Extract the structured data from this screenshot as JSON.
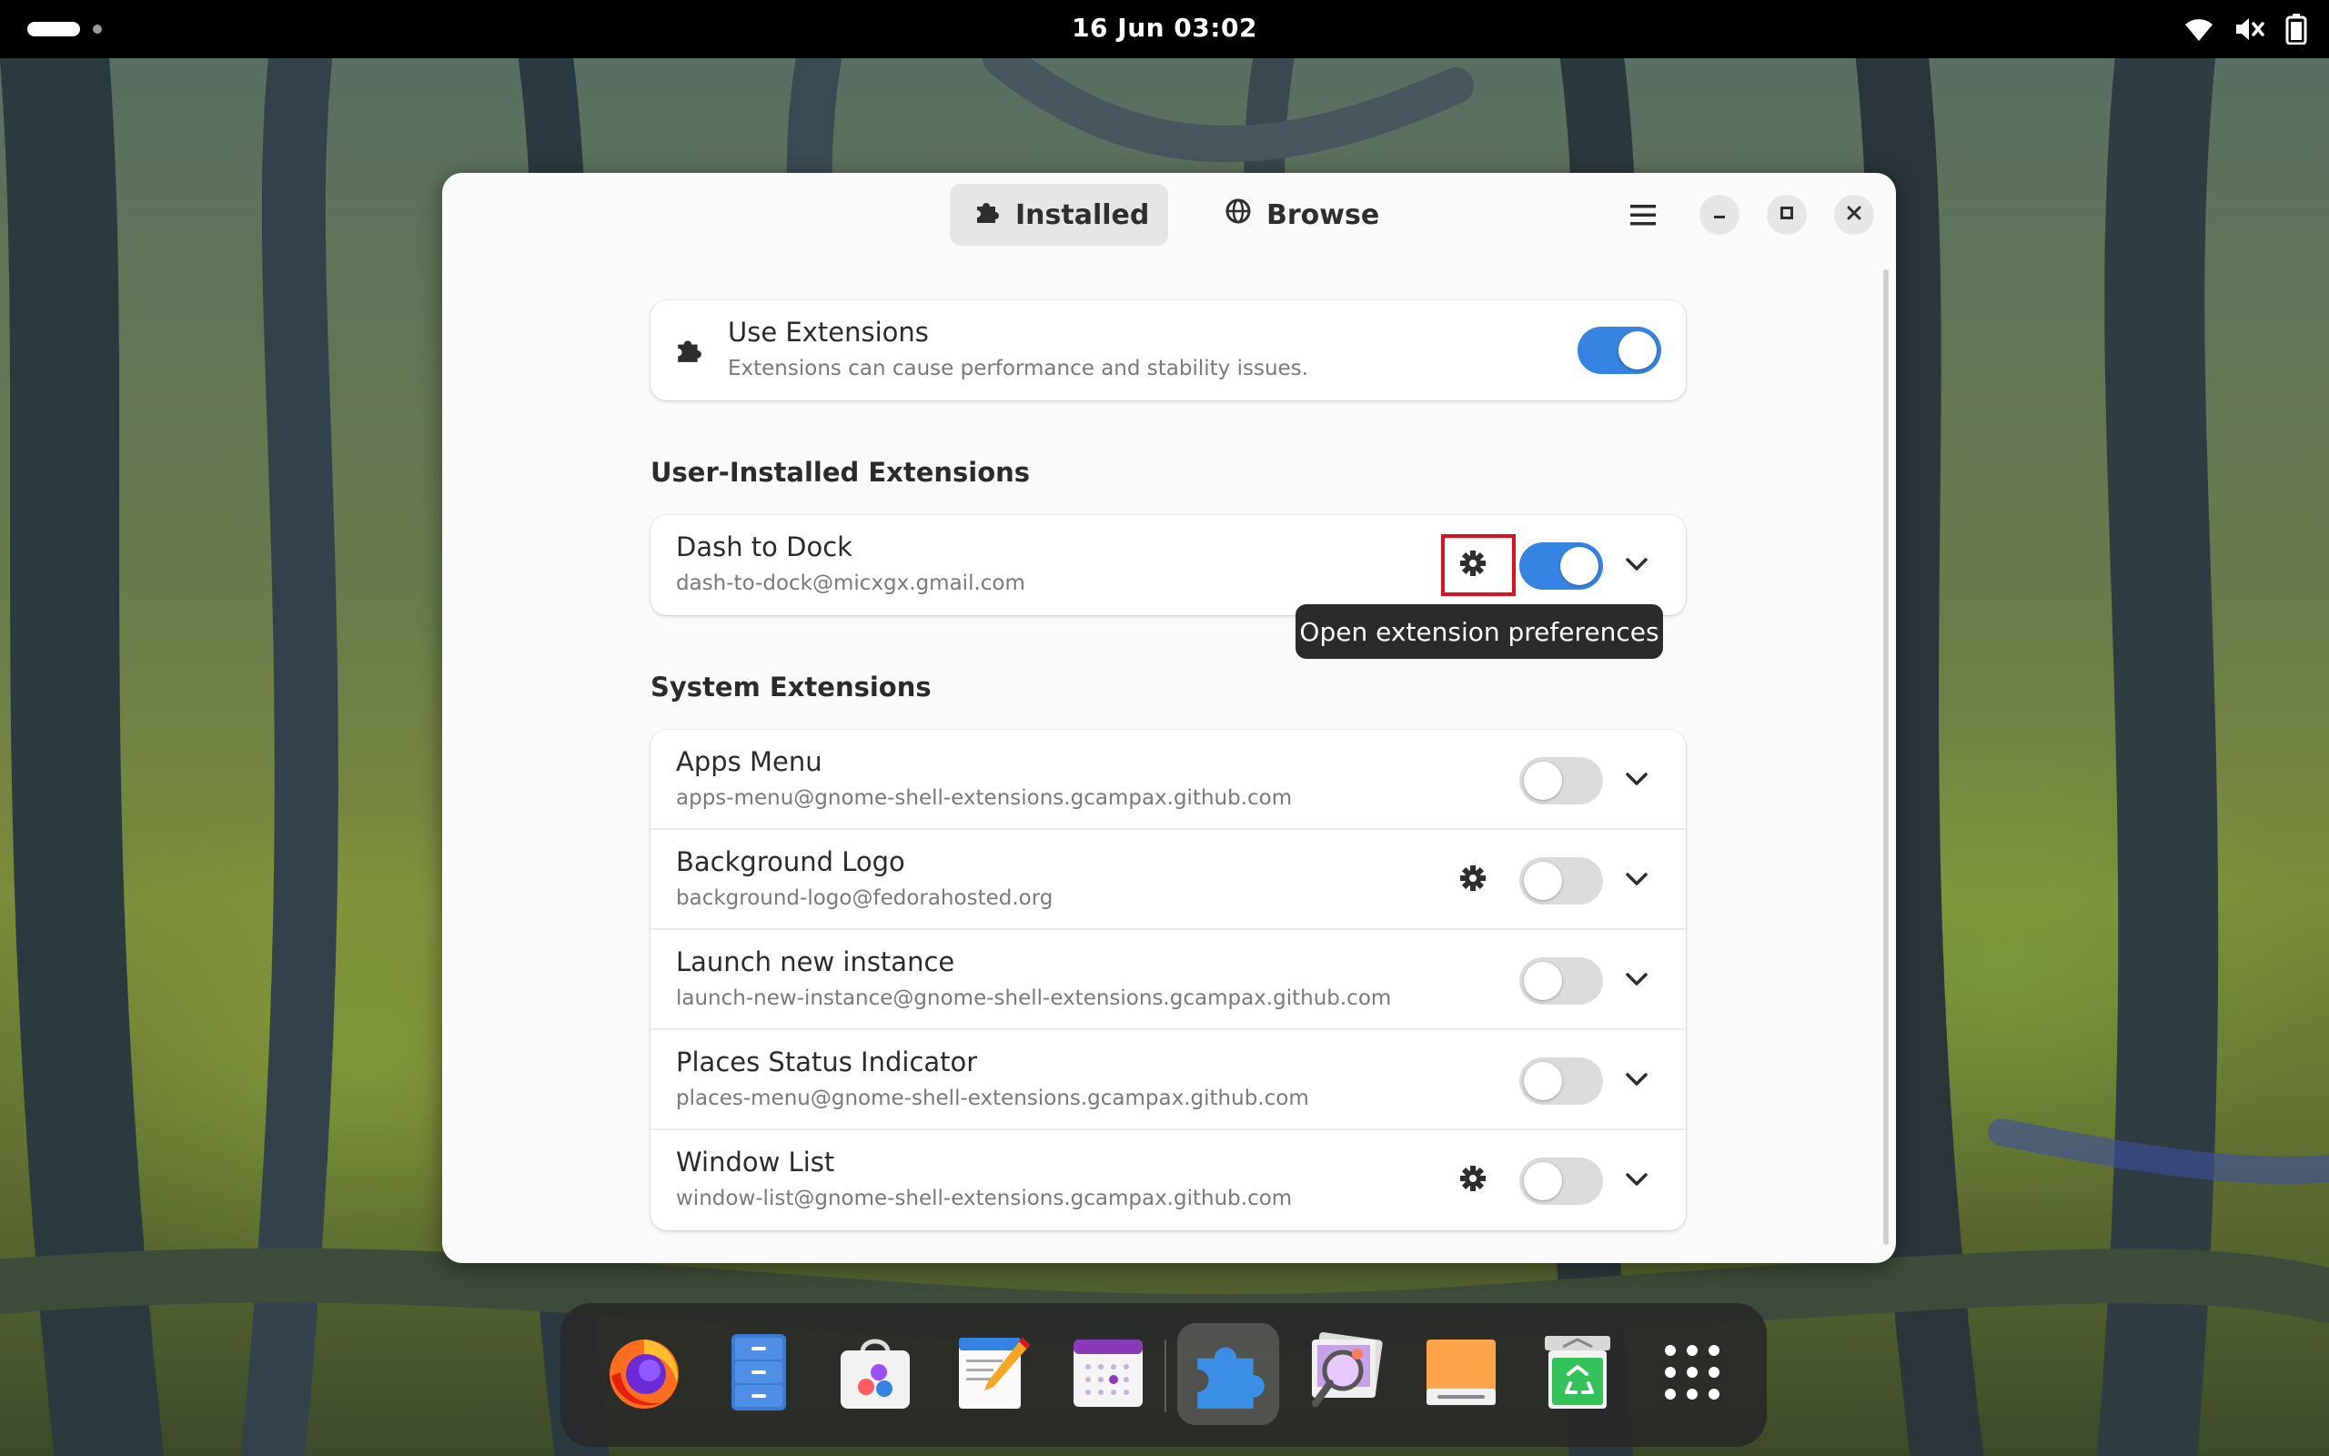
{
  "topbar": {
    "clock": "16 Jun  03:02",
    "tray_icons": [
      "wifi-icon",
      "volume-muted-icon",
      "battery-icon"
    ]
  },
  "window": {
    "tabs": [
      {
        "label": "Installed",
        "icon": "puzzle-icon",
        "active": true
      },
      {
        "label": "Browse",
        "icon": "globe-icon",
        "active": false
      }
    ],
    "use_extensions": {
      "title": "Use Extensions",
      "subtitle": "Extensions can cause performance and stability issues.",
      "enabled": true
    },
    "user_section_title": "User-Installed Extensions",
    "user_extensions": [
      {
        "name": "Dash to Dock",
        "id": "dash-to-dock@micxgx.gmail.com",
        "has_prefs": true,
        "enabled": true
      }
    ],
    "tooltip": "Open extension preferences",
    "system_section_title": "System Extensions",
    "system_extensions": [
      {
        "name": "Apps Menu",
        "id": "apps-menu@gnome-shell-extensions.gcampax.github.com",
        "has_prefs": false,
        "enabled": false
      },
      {
        "name": "Background Logo",
        "id": "background-logo@fedorahosted.org",
        "has_prefs": true,
        "enabled": false
      },
      {
        "name": "Launch new instance",
        "id": "launch-new-instance@gnome-shell-extensions.gcampax.github.com",
        "has_prefs": false,
        "enabled": false
      },
      {
        "name": "Places Status Indicator",
        "id": "places-menu@gnome-shell-extensions.gcampax.github.com",
        "has_prefs": false,
        "enabled": false
      },
      {
        "name": "Window List",
        "id": "window-list@gnome-shell-extensions.gcampax.github.com",
        "has_prefs": true,
        "enabled": false
      }
    ]
  },
  "dock": {
    "apps": [
      "firefox",
      "files",
      "software",
      "text-editor",
      "calendar",
      "extensions",
      "image-viewer",
      "disks",
      "trash",
      "app-grid"
    ],
    "active_app": "extensions"
  },
  "colors": {
    "accent": "#3584e4",
    "highlight": "#e0101e"
  }
}
